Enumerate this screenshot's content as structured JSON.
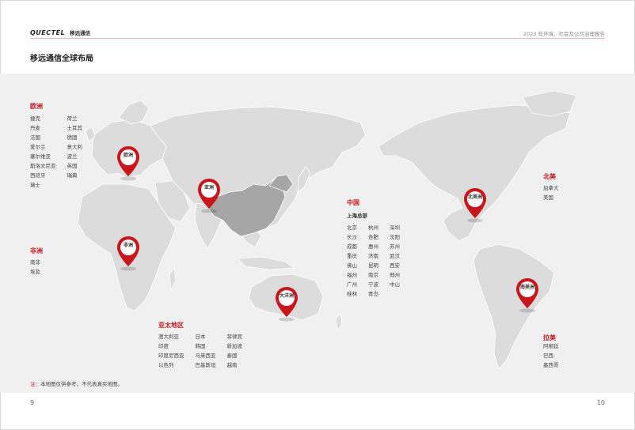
{
  "header": {
    "logo_brand": "QUECTEL",
    "logo_cn": "移远通信",
    "report_title": "2023 年环境、社会及公司治理报告"
  },
  "page_title": "移远通信全球布局",
  "colors": {
    "accent": "#c8161d",
    "land": "#dcdcdc",
    "china": "#a6a6a6",
    "bg": "#f0f0f0"
  },
  "regions": {
    "europe": {
      "title": "欧洲",
      "col1": [
        "捷克",
        "丹麦",
        "法国",
        "爱尔兰",
        "塞尔维亚",
        "斯洛文尼亚",
        "西班牙",
        "瑞士"
      ],
      "col2": [
        "荷兰",
        "土耳其",
        "德国",
        "意大利",
        "波兰",
        "英国",
        "瑞典"
      ]
    },
    "africa": {
      "title": "非洲",
      "col1": [
        "南非",
        "埃及"
      ]
    },
    "china": {
      "title": "中国",
      "hq": "上海总部",
      "col1": [
        "北京",
        "长沙",
        "成都",
        "重庆",
        "佛山",
        "福州",
        "广州",
        "桂林"
      ],
      "col2": [
        "杭州",
        "合肥",
        "惠州",
        "济南",
        "昆明",
        "南京",
        "宁波",
        "青岛"
      ],
      "col3": [
        "深圳",
        "沈阳",
        "苏州",
        "武汉",
        "西安",
        "郑州",
        "中山"
      ]
    },
    "apac": {
      "title": "亚太地区",
      "col1": [
        "澳大利亚",
        "印度",
        "印度尼西亚",
        "以色列"
      ],
      "col2": [
        "日本",
        "韩国",
        "马来西亚",
        "巴基斯坦"
      ],
      "col3": [
        "菲律宾",
        "新加坡",
        "泰国",
        "越南"
      ]
    },
    "north_america": {
      "title": "北美",
      "col1": [
        "加拿大",
        "美国"
      ]
    },
    "latin_america": {
      "title": "拉美",
      "col1": [
        "阿根廷",
        "巴西",
        "墨西哥"
      ]
    }
  },
  "pins": {
    "europe": "欧洲",
    "asia": "亚洲",
    "africa": "非洲",
    "oceania": "大洋洲",
    "north_america": "北美洲",
    "south_america": "南美洲"
  },
  "note": {
    "prefix": "注：",
    "text": "本地图仅供参考，不代表真实地图。"
  },
  "page_numbers": {
    "left": "9",
    "right": "10"
  }
}
